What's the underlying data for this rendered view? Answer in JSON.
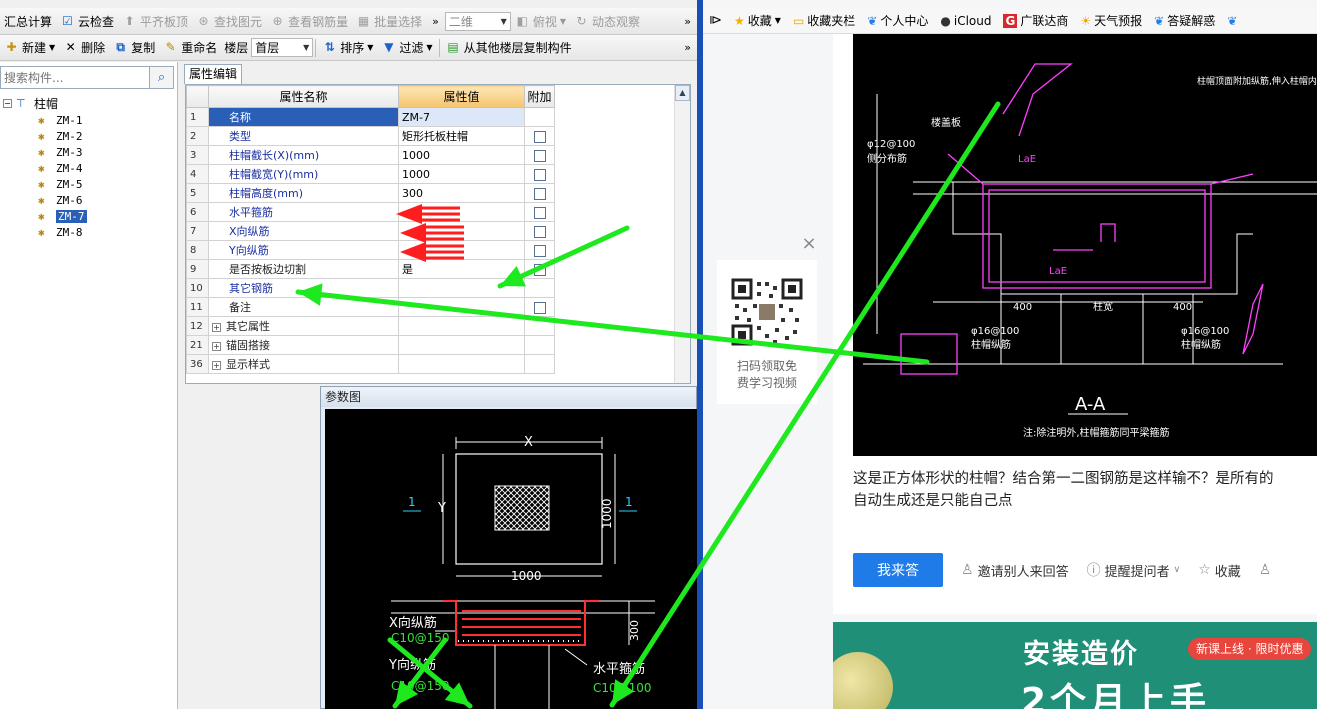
{
  "app": {
    "toolbar1": {
      "summary": "汇总计算",
      "cloud_check": "云检查",
      "align_top": "平齐板顶",
      "find_element": "查找图元",
      "view_rebar": "查看钢筋量",
      "batch_select": "批量选择",
      "view_mode": "二维",
      "top_view": "俯视",
      "dynamic_view": "动态观察",
      "more": "»"
    },
    "toolbar2": {
      "new": "新建",
      "delete": "删除",
      "copy": "复制",
      "rename": "重命名",
      "floor_label": "楼层",
      "floor_value": "首层",
      "sort": "排序",
      "filter": "过滤",
      "copy_from_floor": "从其他楼层复制构件",
      "more": "»"
    },
    "search": {
      "placeholder": "搜索构件..."
    },
    "tree": {
      "root": "柱帽",
      "items": [
        "ZM-1",
        "ZM-2",
        "ZM-3",
        "ZM-4",
        "ZM-5",
        "ZM-6",
        "ZM-7",
        "ZM-8"
      ],
      "selected": "ZM-7"
    },
    "property_tab": "属性编辑",
    "grid": {
      "headers": {
        "name": "属性名称",
        "value": "属性值",
        "extra": "附加"
      },
      "rows": [
        {
          "num": "1",
          "name": "名称",
          "value": "ZM-7",
          "check": false
        },
        {
          "num": "2",
          "name": "类型",
          "value": "矩形托板柱帽",
          "check": true
        },
        {
          "num": "3",
          "name": "柱帽截长(X)(mm)",
          "value": "1000",
          "check": true
        },
        {
          "num": "4",
          "name": "柱帽截宽(Y)(mm)",
          "value": "1000",
          "check": true
        },
        {
          "num": "5",
          "name": "柱帽高度(mm)",
          "value": "300",
          "check": true
        },
        {
          "num": "6",
          "name": "水平箍筋",
          "value": "",
          "check": true
        },
        {
          "num": "7",
          "name": "X向纵筋",
          "value": "",
          "check": true
        },
        {
          "num": "8",
          "name": "Y向纵筋",
          "value": "",
          "check": true
        },
        {
          "num": "9",
          "name": "是否按板边切割",
          "value": "是",
          "check": true
        },
        {
          "num": "10",
          "name": "其它钢筋",
          "value": "",
          "check": false
        },
        {
          "num": "11",
          "name": "备注",
          "value": "",
          "check": true
        },
        {
          "num": "12",
          "name": "其它属性",
          "value": "",
          "check": false
        },
        {
          "num": "21",
          "name": "锚固搭接",
          "value": "",
          "check": false
        },
        {
          "num": "36",
          "name": "显示样式",
          "value": "",
          "check": false
        }
      ]
    },
    "param_window": {
      "title": "参数图",
      "dim_x": "X",
      "dim_y": "Y",
      "dim_1000_h": "1000",
      "dim_1000_v": "1000",
      "section_mark": "1",
      "dim_300": "300",
      "label_x_rebar": "X向纵筋",
      "label_x_rebar_spec": "C10@150",
      "label_y_rebar": "Y向纵筋",
      "label_y_rebar_spec": "C10@150",
      "label_hoop": "水平箍筋",
      "label_hoop_spec": "C10@100"
    }
  },
  "browser": {
    "bookmarks": [
      "收藏",
      "收藏夹栏",
      "个人中心",
      "iCloud",
      "广联达商",
      "天气预报",
      "答疑解惑"
    ],
    "qr": {
      "line1": "扫码领取免",
      "line2": "费学习视频",
      "close": "×"
    },
    "drawing": {
      "title": "A-A",
      "subtitle": "注:除注明外,柱帽箍筋同平梁箍筋",
      "lae1": "LaE",
      "lae2": "LaE",
      "dim_left": "400",
      "dim_mid": "柱宽",
      "dim_right": "400",
      "rebar_top_left": "φ12@100",
      "rebar_top_left_sub": "侧分布筋",
      "rebar_bot_left": "φ16@100",
      "rebar_bot_left_sub": "柱帽纵筋",
      "rebar_bot_right": "φ16@100",
      "rebar_bot_right_sub": "柱帽纵筋",
      "note_top": "柱帽顶面附加纵筋,伸入柱帽内",
      "label_slab": "楼盖板"
    },
    "question": {
      "line1": "这是正方体形状的柱帽？结合第一二图钢筋是这样输不？是所有的",
      "line2": "自动生成还是只能自己点"
    },
    "actions": {
      "answer": "我来答",
      "invite": "邀请别人来回答",
      "remind": "提醒提问者",
      "favorite": "收藏"
    },
    "banner": {
      "title": "安装造价",
      "tag": "新课上线 · 限时优惠",
      "big": "2个月上手"
    }
  },
  "annotations": {
    "arrow_color": "#1ee81e",
    "marker_color": "#ff1e1e"
  }
}
